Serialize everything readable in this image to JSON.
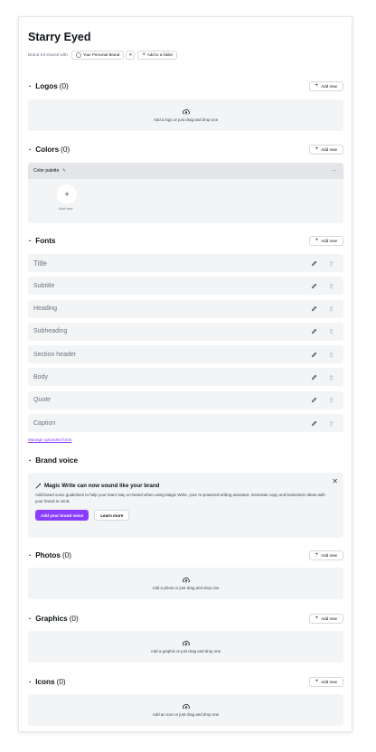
{
  "header": {
    "title": "Starry Eyed",
    "shared_with_label": "Brand Kit shared with:",
    "shared_chip": "Your Personal Brand",
    "remove_icon": "✕",
    "add_folder_label": "Add to a folder"
  },
  "logos": {
    "title": "Logos",
    "count": "(0)",
    "add_label": "Add new",
    "drop_text": "Add a logo or just drag and drop one"
  },
  "colors": {
    "title": "Colors",
    "count": "(0)",
    "add_label": "Add new",
    "palette_title": "Color palette",
    "more_label": "···",
    "add_color_label": "Add new"
  },
  "fonts": {
    "title": "Fonts",
    "add_label": "Add new",
    "items": [
      {
        "label": "Title"
      },
      {
        "label": "Subtitle"
      },
      {
        "label": "Heading"
      },
      {
        "label": "Subheading"
      },
      {
        "label": "Section header"
      },
      {
        "label": "Body"
      },
      {
        "label": "Quote"
      },
      {
        "label": "Caption"
      }
    ],
    "manage_link": "Manage uploaded fonts"
  },
  "brand_voice": {
    "title": "Brand voice",
    "card_title": "Magic Write can now sound like your brand",
    "card_desc": "Add brand voice guidelines to help your team stay on-brand when using Magic Write, your AI-powered writing assistant. Generate copy and brainstorm ideas with your brand in mind.",
    "primary_btn": "Add your brand voice",
    "secondary_btn": "Learn more",
    "close_icon": "✕"
  },
  "photos": {
    "title": "Photos",
    "count": "(0)",
    "add_label": "Add new",
    "drop_text": "Add a photo or just drag and drop one"
  },
  "graphics": {
    "title": "Graphics",
    "count": "(0)",
    "add_label": "Add new",
    "drop_text": "Add a graphic or just drag and drop one"
  },
  "icons": {
    "title": "Icons",
    "count": "(0)",
    "add_label": "Add new",
    "drop_text": "Add an icon or just drag and drop one"
  },
  "colors_theme": {
    "accent": "#8b3dff",
    "panel": "#f3f4f6"
  }
}
